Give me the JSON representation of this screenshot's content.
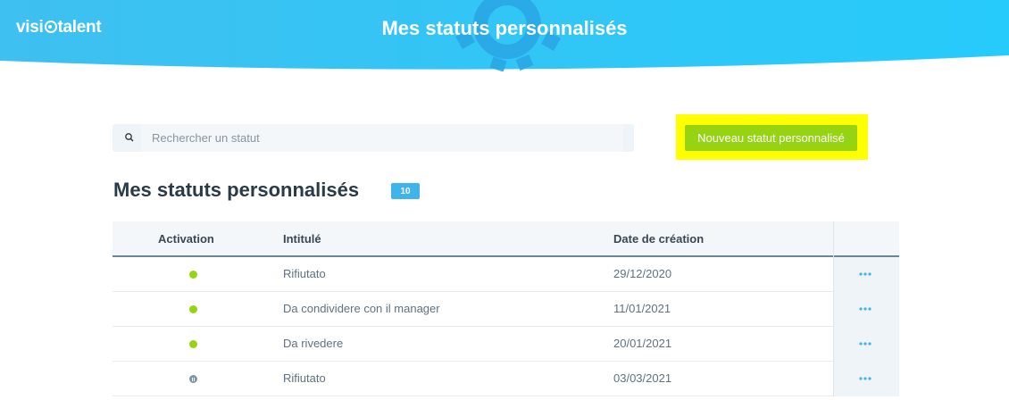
{
  "header": {
    "logo_text_left": "visi",
    "logo_text_right": "talent",
    "title": "Mes statuts personnalisés"
  },
  "search": {
    "placeholder": "Rechercher un statut",
    "icon": "search-icon"
  },
  "new_button": {
    "label": "Nouveau statut personnalisé"
  },
  "section": {
    "title": "Mes statuts personnalisés",
    "count": "10"
  },
  "table": {
    "columns": [
      "Activation",
      "Intitulé",
      "Date de création"
    ],
    "rows": [
      {
        "status": "active",
        "label": "Rifiutato",
        "date": "29/12/2020"
      },
      {
        "status": "active",
        "label": "Da condividere con il manager",
        "date": "11/01/2021"
      },
      {
        "status": "active",
        "label": "Da rivedere",
        "date": "20/01/2021"
      },
      {
        "status": "paused",
        "label": "Rifiutato",
        "date": "03/03/2021"
      }
    ]
  },
  "colors": {
    "header_gradient_start": "#3ec0f0",
    "header_gradient_end": "#26cbfb",
    "accent_green": "#96d312",
    "badge_blue": "#3fb3ec",
    "highlight_yellow": "#ffff00"
  }
}
